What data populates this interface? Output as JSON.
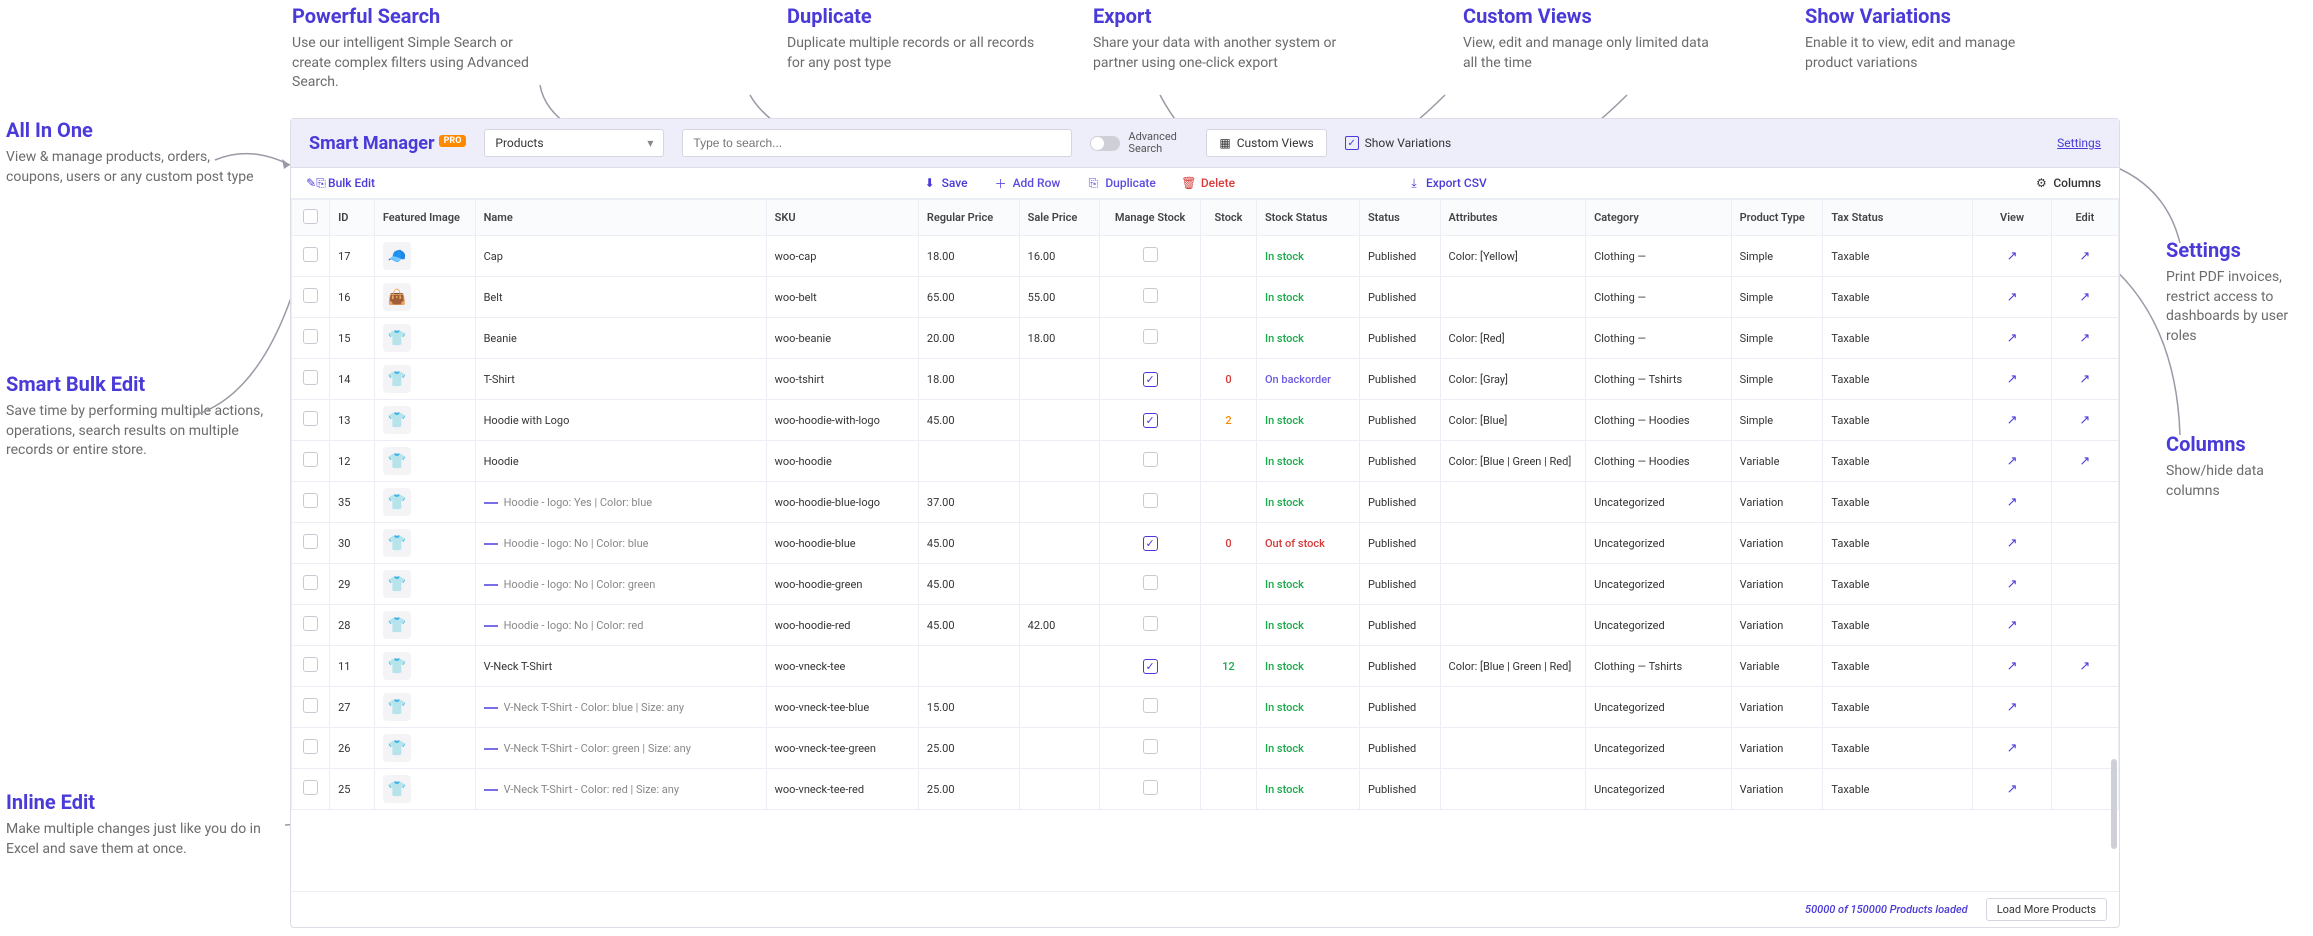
{
  "callouts": {
    "all_in_one": {
      "title": "All In One",
      "desc": "View & manage products, orders, coupons, users or any custom post type"
    },
    "powerful_search": {
      "title": "Powerful Search",
      "desc": "Use our intelligent Simple Search or create complex filters using Advanced Search."
    },
    "duplicate": {
      "title": "Duplicate",
      "desc": "Duplicate multiple records or all records for any post type"
    },
    "export": {
      "title": "Export",
      "desc": "Share your data with another system or partner using one-click export"
    },
    "custom_views": {
      "title": "Custom Views",
      "desc": "View, edit and manage only limited data all the time"
    },
    "show_variations": {
      "title": "Show Variations",
      "desc": "Enable it to view, edit and manage product variations"
    },
    "settings": {
      "title": "Settings",
      "desc": "Print PDF invoices, restrict access to dashboards by user roles"
    },
    "smart_bulk": {
      "title": "Smart Bulk Edit",
      "desc": "Save time by performing multiple actions, operations, search results on multiple records or entire store."
    },
    "inline_edit": {
      "title": "Inline Edit",
      "desc": "Make multiple changes just like you do in Excel and save them at once."
    },
    "columns": {
      "title": "Columns",
      "desc": "Show/hide data columns"
    }
  },
  "brand": {
    "name": "Smart Manager",
    "tag": "PRO"
  },
  "topbar": {
    "dropdown_value": "Products",
    "search_placeholder": "Type to search...",
    "adv_search": "Advanced Search",
    "custom_views": "Custom Views",
    "show_variations": "Show Variations",
    "settings_link": "Settings"
  },
  "actions": {
    "bulk_edit": "Bulk Edit",
    "save": "Save",
    "add_row": "Add Row",
    "duplicate": "Duplicate",
    "delete": "Delete",
    "export_csv": "Export CSV",
    "columns": "Columns"
  },
  "columns": [
    "",
    "ID",
    "Featured Image",
    "Name",
    "SKU",
    "Regular Price",
    "Sale Price",
    "Manage Stock",
    "Stock",
    "Stock Status",
    "Status",
    "Attributes",
    "Category",
    "Product Type",
    "Tax Status",
    "View",
    "Edit"
  ],
  "rows": [
    {
      "id": "17",
      "img": "🧢",
      "name": "Cap",
      "sku": "woo-cap",
      "rprice": "18.00",
      "sprice": "16.00",
      "mstock": false,
      "stock": "",
      "sstatus": "In stock",
      "sclass": "stock-green",
      "status": "Published",
      "attr": "Color: [Yellow]",
      "cat": "Clothing —",
      "ptype": "Simple",
      "tax": "Taxable",
      "variation": false
    },
    {
      "id": "16",
      "img": "👜",
      "name": "Belt",
      "sku": "woo-belt",
      "rprice": "65.00",
      "sprice": "55.00",
      "mstock": false,
      "stock": "",
      "sstatus": "In stock",
      "sclass": "stock-green",
      "status": "Published",
      "attr": "",
      "cat": "Clothing —",
      "ptype": "Simple",
      "tax": "Taxable",
      "variation": false
    },
    {
      "id": "15",
      "img": "👕",
      "name": "Beanie",
      "sku": "woo-beanie",
      "rprice": "20.00",
      "sprice": "18.00",
      "mstock": false,
      "stock": "",
      "sstatus": "In stock",
      "sclass": "stock-green",
      "status": "Published",
      "attr": "Color: [Red]",
      "cat": "Clothing —",
      "ptype": "Simple",
      "tax": "Taxable",
      "variation": false
    },
    {
      "id": "14",
      "img": "👕",
      "name": "T-Shirt",
      "sku": "woo-tshirt",
      "rprice": "18.00",
      "sprice": "",
      "mstock": true,
      "stock": "0",
      "stockclass": "stock-red",
      "sstatus": "On backorder",
      "sclass": "stock-back",
      "status": "Published",
      "attr": "Color: [Gray]",
      "cat": "Clothing — Tshirts",
      "ptype": "Simple",
      "tax": "Taxable",
      "variation": false
    },
    {
      "id": "13",
      "img": "👕",
      "name": "Hoodie with Logo",
      "sku": "woo-hoodie-with-logo",
      "rprice": "45.00",
      "sprice": "",
      "mstock": true,
      "stock": "2",
      "stockclass": "stock-orange",
      "sstatus": "In stock",
      "sclass": "stock-green",
      "status": "Published",
      "attr": "Color: [Blue]",
      "cat": "Clothing — Hoodies",
      "ptype": "Simple",
      "tax": "Taxable",
      "variation": false
    },
    {
      "id": "12",
      "img": "👕",
      "name": "Hoodie",
      "sku": "woo-hoodie",
      "rprice": "",
      "sprice": "",
      "mstock": false,
      "stock": "",
      "sstatus": "In stock",
      "sclass": "stock-green",
      "status": "Published",
      "attr": "Color: [Blue | Green | Red]",
      "cat": "Clothing — Hoodies",
      "ptype": "Variable",
      "tax": "Taxable",
      "variation": false
    },
    {
      "id": "35",
      "img": "👕",
      "name": "Hoodie - logo: Yes | Color: blue",
      "sku": "woo-hoodie-blue-logo",
      "rprice": "37.00",
      "sprice": "",
      "mstock": false,
      "stock": "",
      "sstatus": "In stock",
      "sclass": "stock-green",
      "status": "Published",
      "attr": "",
      "cat": "Uncategorized",
      "catclass": "cat-gray",
      "ptype": "Variation",
      "ptclass": "ptype-var",
      "tax": "Taxable",
      "variation": true
    },
    {
      "id": "30",
      "img": "👕",
      "name": "Hoodie - logo: No | Color: blue",
      "sku": "woo-hoodie-blue",
      "rprice": "45.00",
      "sprice": "",
      "mstock": true,
      "stock": "0",
      "stockclass": "stock-red",
      "sstatus": "Out of stock",
      "sclass": "stock-red",
      "status": "Published",
      "attr": "",
      "cat": "Uncategorized",
      "catclass": "cat-gray",
      "ptype": "Variation",
      "ptclass": "ptype-var",
      "tax": "Taxable",
      "variation": true
    },
    {
      "id": "29",
      "img": "👕",
      "name": "Hoodie - logo: No | Color: green",
      "sku": "woo-hoodie-green",
      "rprice": "45.00",
      "sprice": "",
      "mstock": false,
      "stock": "",
      "sstatus": "In stock",
      "sclass": "stock-green",
      "status": "Published",
      "attr": "",
      "cat": "Uncategorized",
      "catclass": "cat-gray",
      "ptype": "Variation",
      "ptclass": "ptype-var",
      "tax": "Taxable",
      "variation": true
    },
    {
      "id": "28",
      "img": "👕",
      "name": "Hoodie - logo: No | Color: red",
      "sku": "woo-hoodie-red",
      "rprice": "45.00",
      "sprice": "42.00",
      "mstock": false,
      "stock": "",
      "sstatus": "In stock",
      "sclass": "stock-green",
      "status": "Published",
      "attr": "",
      "cat": "Uncategorized",
      "catclass": "cat-gray",
      "ptype": "Variation",
      "ptclass": "ptype-var",
      "tax": "Taxable",
      "variation": true
    },
    {
      "id": "11",
      "img": "👕",
      "name": "V-Neck T-Shirt",
      "sku": "woo-vneck-tee",
      "rprice": "",
      "sprice": "",
      "mstock": true,
      "stock": "12",
      "stockclass": "stock-green",
      "sstatus": "In stock",
      "sclass": "stock-green",
      "status": "Published",
      "attr": "Color: [Blue | Green | Red]",
      "cat": "Clothing — Tshirts",
      "ptype": "Variable",
      "tax": "Taxable",
      "variation": false
    },
    {
      "id": "27",
      "img": "👕",
      "name": "V-Neck T-Shirt - Color: blue | Size: any",
      "sku": "woo-vneck-tee-blue",
      "rprice": "15.00",
      "sprice": "",
      "mstock": false,
      "stock": "",
      "sstatus": "In stock",
      "sclass": "stock-green",
      "status": "Published",
      "attr": "",
      "cat": "Uncategorized",
      "catclass": "cat-gray",
      "ptype": "Variation",
      "ptclass": "ptype-var",
      "tax": "Taxable",
      "variation": true
    },
    {
      "id": "26",
      "img": "👕",
      "name": "V-Neck T-Shirt - Color: green | Size: any",
      "sku": "woo-vneck-tee-green",
      "rprice": "25.00",
      "sprice": "",
      "mstock": false,
      "stock": "",
      "sstatus": "In stock",
      "sclass": "stock-green",
      "status": "Published",
      "attr": "",
      "cat": "Uncategorized",
      "catclass": "cat-gray",
      "ptype": "Variation",
      "ptclass": "ptype-var",
      "tax": "Taxable",
      "variation": true
    },
    {
      "id": "25",
      "img": "👕",
      "name": "V-Neck T-Shirt - Color: red | Size: any",
      "sku": "woo-vneck-tee-red",
      "rprice": "25.00",
      "sprice": "",
      "mstock": false,
      "stock": "",
      "sstatus": "In stock",
      "sclass": "stock-green",
      "status": "Published",
      "attr": "",
      "cat": "Uncategorized",
      "catclass": "cat-gray",
      "ptype": "Variation",
      "ptclass": "ptype-var",
      "tax": "Taxable",
      "variation": true
    }
  ],
  "footer": {
    "status": "50000 of 150000 Products loaded",
    "load_more": "Load More Products"
  }
}
